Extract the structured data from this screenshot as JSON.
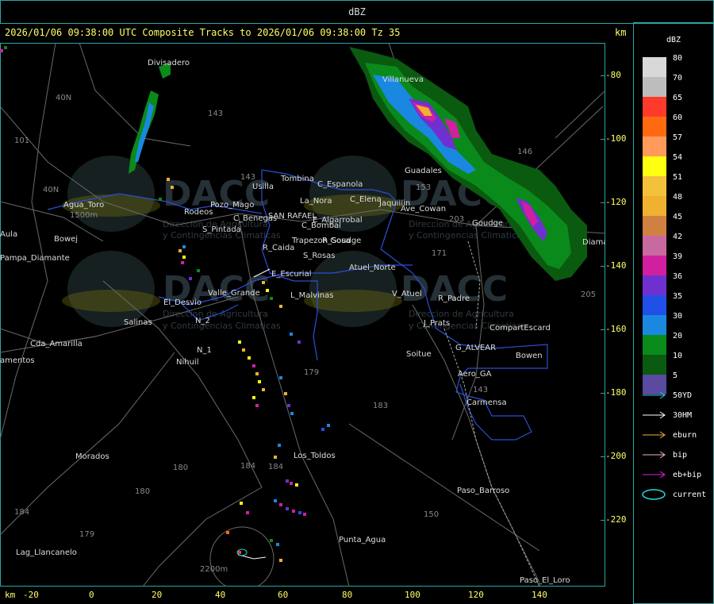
{
  "window": {
    "title": "dBZ"
  },
  "header": {
    "text": "2026/01/06 09:38:00 UTC Composite Tracks to 2026/01/06 09:38:00 Tz 35",
    "km_label": "km"
  },
  "axes": {
    "y_ticks": [
      "-80",
      "-100",
      "-120",
      "-140",
      "-160",
      "-180",
      "-200",
      "-220"
    ],
    "x_ticks": [
      "-20",
      "0",
      "20",
      "40",
      "60",
      "80",
      "100",
      "120",
      "140"
    ],
    "x_unit": "km"
  },
  "legend": {
    "title": "dBZ",
    "scale": [
      {
        "label": "80",
        "color": "#d8d8d8"
      },
      {
        "label": "70",
        "color": "#bdbdbd"
      },
      {
        "label": "65",
        "color": "#ff3a2a"
      },
      {
        "label": "60",
        "color": "#ff6a10"
      },
      {
        "label": "57",
        "color": "#ff9a5a"
      },
      {
        "label": "54",
        "color": "#ffff10"
      },
      {
        "label": "51",
        "color": "#f4c23a"
      },
      {
        "label": "48",
        "color": "#f0b030"
      },
      {
        "label": "45",
        "color": "#d08040"
      },
      {
        "label": "42",
        "color": "#c86aa0"
      },
      {
        "label": "39",
        "color": "#d020a0"
      },
      {
        "label": "36",
        "color": "#7030d0"
      },
      {
        "label": "35",
        "color": "#2050e8"
      },
      {
        "label": "30",
        "color": "#1a88e0"
      },
      {
        "label": "20",
        "color": "#0a8a1a"
      },
      {
        "label": "10",
        "color": "#0a5a10"
      },
      {
        "label": "5",
        "color": "#5a4aa0"
      }
    ],
    "tracks": [
      {
        "label": "50YD",
        "color": "#22cccc"
      },
      {
        "label": "30HM",
        "color": "#ffffff"
      },
      {
        "label": "eburn",
        "color": "#f0b040"
      },
      {
        "label": "bip",
        "color": "#f0b0d0"
      },
      {
        "label": "eb+bip",
        "color": "#e020e0"
      },
      {
        "label": "current",
        "color": "#22dddd"
      }
    ]
  },
  "places": [
    {
      "name": "Divisadero"
    },
    {
      "name": "Villanueva"
    },
    {
      "name": "Tombina"
    },
    {
      "name": "Usilla"
    },
    {
      "name": "C_Espanola"
    },
    {
      "name": "Guadales"
    },
    {
      "name": "C_Elena"
    },
    {
      "name": "Jaquillin"
    },
    {
      "name": "Ave_Cowan"
    },
    {
      "name": "Goudge"
    },
    {
      "name": "La_Nora"
    },
    {
      "name": "C_Benegas"
    },
    {
      "name": "SAN RAFAEL"
    },
    {
      "name": "E_Algarrobal"
    },
    {
      "name": "C_Bombal"
    },
    {
      "name": "R_Sosa"
    },
    {
      "name": "Agua_Toro"
    },
    {
      "name": "Pozo_Mago"
    },
    {
      "name": "Rodeos"
    },
    {
      "name": "S_Pintada"
    },
    {
      "name": "Trapezon Goudge"
    },
    {
      "name": "R_Caida"
    },
    {
      "name": "S_Rosas"
    },
    {
      "name": "Atuel_Norte"
    },
    {
      "name": "E_Escurial"
    },
    {
      "name": "V_Atuel"
    },
    {
      "name": "R_Padre"
    },
    {
      "name": "Valle_Grande"
    },
    {
      "name": "L_Malvinas"
    },
    {
      "name": "El_Desvio"
    },
    {
      "name": "Salinas"
    },
    {
      "name": "N_2"
    },
    {
      "name": "J_Prats"
    },
    {
      "name": "CompartEscard"
    },
    {
      "name": "Cda_Amarilla"
    },
    {
      "name": "N_1"
    },
    {
      "name": "Nihuil"
    },
    {
      "name": "G_ALVEAR"
    },
    {
      "name": "Bowen"
    },
    {
      "name": "Soitue"
    },
    {
      "name": "Aero_GA"
    },
    {
      "name": "Carmensa"
    },
    {
      "name": "Morados"
    },
    {
      "name": "Los_Toldos"
    },
    {
      "name": "Paso_Barroso"
    },
    {
      "name": "Punta_Agua"
    },
    {
      "name": "Lag_Llancanelo"
    },
    {
      "name": "Paso_El_Loro"
    },
    {
      "name": "Pampa_Diamante"
    },
    {
      "name": "Bowej"
    },
    {
      "name": "Diamante"
    },
    {
      "name": "Aula"
    },
    {
      "name": "amentos"
    }
  ],
  "roads": [
    "40N",
    "40N",
    "143",
    "143",
    "101",
    "146",
    "153",
    "171",
    "180",
    "184",
    "180",
    "179",
    "150",
    "184",
    "179",
    "183",
    "143",
    "203",
    "205",
    "184"
  ],
  "watermark": {
    "logo": "DACC",
    "line1": "Direccion de Agricultura",
    "line2": "y Contingencias Climaticas",
    "url": "http://www.contingencias.mendoza.gov.ar"
  },
  "map_annotations": {
    "elev1": "1500m",
    "elev2": "2200m",
    "n_label": "N",
    "n2": "N"
  }
}
